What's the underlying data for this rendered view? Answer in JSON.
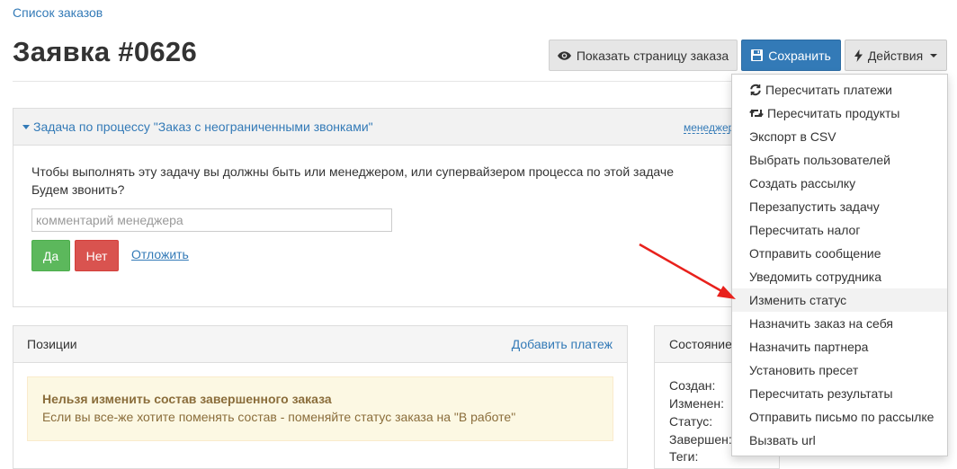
{
  "breadcrumb": {
    "label": "Список заказов"
  },
  "page": {
    "title": "Заявка #0626"
  },
  "toolbar": {
    "show_page_label": "Показать страницу заказа",
    "show_page_icon": "eye-icon",
    "save_label": "Сохранить",
    "save_icon": "floppy-icon",
    "actions_label": "Действия",
    "actions_icon": "bolt-icon"
  },
  "task": {
    "title": "Задача по процессу \"Заказ с неограниченными звонками\"",
    "manager_link": "менеджер",
    "message": "Чтобы выполнять эту задачу вы должны быть или менеджером, или супервайзером процесса по этой задаче",
    "question": "Будем звонить?",
    "comment_placeholder": "комментарий менеджера",
    "comment_value": "",
    "yes_label": "Да",
    "no_label": "Нет",
    "postpone_label": "Отложить"
  },
  "positions": {
    "title": "Позиции",
    "add_payment": "Добавить платеж",
    "alert_title": "Нельзя изменить состав завершенного заказа",
    "alert_text": "Если вы все-же хотите поменять состав - поменяйте статус заказа на \"В работе\""
  },
  "state": {
    "title": "Состояние",
    "labels": [
      "Создан:",
      "Изменен:",
      "Статус:",
      "Завершен:",
      "Теги:"
    ]
  },
  "actions_menu": {
    "highlighted_index": 9,
    "items": [
      {
        "label": "Пересчитать платежи",
        "icon": "refresh-icon"
      },
      {
        "label": "Пересчитать продукты",
        "icon": "retweet-icon"
      },
      {
        "label": "Экспорт в CSV"
      },
      {
        "label": "Выбрать пользователей"
      },
      {
        "label": "Создать рассылку"
      },
      {
        "label": "Перезапустить задачу"
      },
      {
        "label": "Пересчитать налог"
      },
      {
        "label": "Отправить сообщение"
      },
      {
        "label": "Уведомить сотрудника"
      },
      {
        "label": "Изменить статус"
      },
      {
        "label": "Назначить заказ на себя"
      },
      {
        "label": "Назначить партнера"
      },
      {
        "label": "Установить пресет"
      },
      {
        "label": "Пересчитать результаты"
      },
      {
        "label": "Отправить письмо по рассылке"
      },
      {
        "label": "Вызвать url"
      }
    ]
  },
  "colors": {
    "link": "#337ab7",
    "primary": "#337ab7",
    "success": "#5cb85c",
    "danger": "#d9534f",
    "annotation_arrow": "#e8211c"
  }
}
